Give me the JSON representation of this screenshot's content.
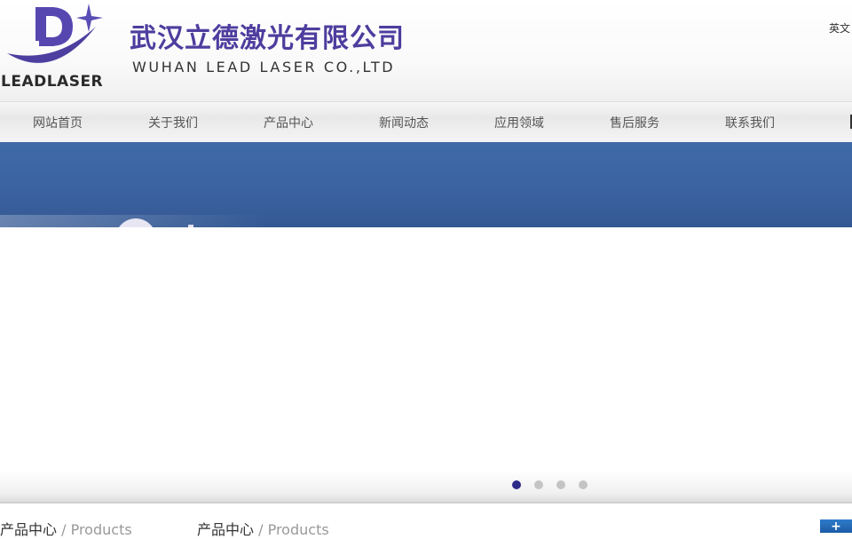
{
  "header": {
    "logo_text": "LEADLASER",
    "cn_title": "武汉立德激光有限公司",
    "en_title": "WUHAN LEAD LASER CO.,LTD",
    "lang_link": "英文"
  },
  "nav": {
    "items": [
      {
        "label": "网站首页"
      },
      {
        "label": "关于我们"
      },
      {
        "label": "产品中心"
      },
      {
        "label": "新闻动态"
      },
      {
        "label": "应用领域"
      },
      {
        "label": "售后服务"
      },
      {
        "label": "联系我们"
      }
    ]
  },
  "slider": {
    "dots": 4,
    "active_index": 0
  },
  "sections": [
    {
      "title": "产品中心",
      "sub": "/ Products"
    },
    {
      "title": "产品中心",
      "sub": "/ Products"
    }
  ],
  "more_button": {
    "label": "+"
  },
  "colors": {
    "brand_purple": "#4e3d9e",
    "banner_blue": "#3f6aa8",
    "dot_active": "#2d2a8a",
    "more_blue": "#1c5ca6"
  }
}
